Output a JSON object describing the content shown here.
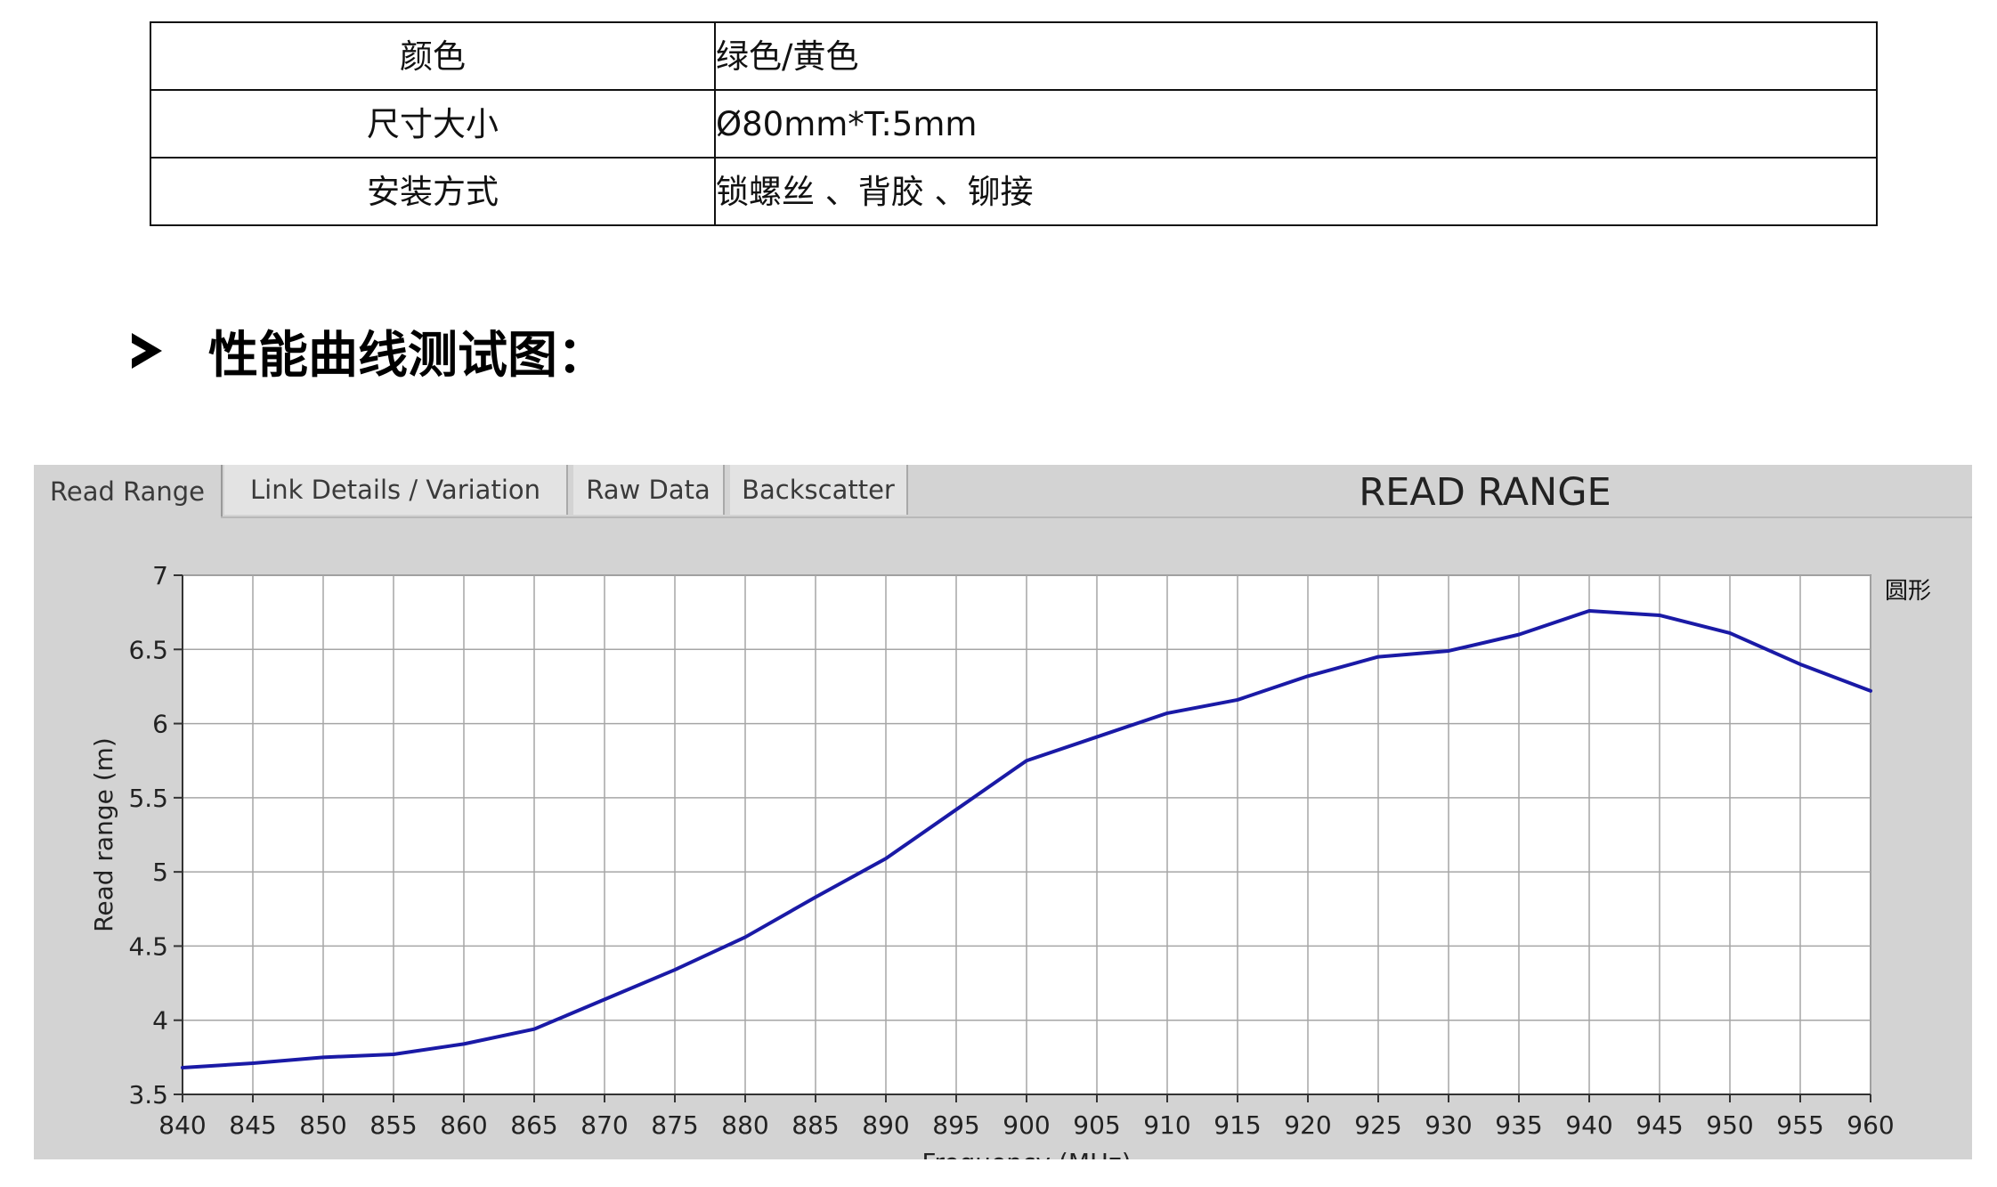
{
  "specs": [
    {
      "key": "颜色",
      "value": "绿色/黄色"
    },
    {
      "key": "尺寸大小",
      "value": "Ø80mm*T:5mm"
    },
    {
      "key": "安装方式",
      "value": "锁螺丝 、背胶 、铆接"
    }
  ],
  "section": {
    "heading": "性能曲线测试图："
  },
  "app": {
    "tabs": [
      {
        "label": "Read Range",
        "active": true
      },
      {
        "label": "Link Details / Variation",
        "active": false
      },
      {
        "label": "Raw Data",
        "active": false
      },
      {
        "label": "Backscatter",
        "active": false
      }
    ]
  },
  "chart_data": {
    "type": "line",
    "title": "READ RANGE",
    "xlabel": "Frequency (MHz)",
    "ylabel": "Read range (m)",
    "xlim": [
      840,
      960
    ],
    "ylim": [
      3.5,
      7
    ],
    "xticks": [
      840,
      845,
      850,
      855,
      860,
      865,
      870,
      875,
      880,
      885,
      890,
      895,
      900,
      905,
      910,
      915,
      920,
      925,
      930,
      935,
      940,
      945,
      950,
      955,
      960
    ],
    "yticks": [
      3.5,
      4,
      4.5,
      5,
      5.5,
      6,
      6.5,
      7
    ],
    "grid": true,
    "legend": "right",
    "series": [
      {
        "name": "圆形",
        "color": "#1a1aa6",
        "x": [
          840,
          845,
          850,
          855,
          860,
          865,
          870,
          875,
          880,
          885,
          890,
          895,
          900,
          905,
          910,
          915,
          920,
          925,
          930,
          935,
          940,
          945,
          950,
          955,
          960
        ],
        "y": [
          3.68,
          3.71,
          3.75,
          3.77,
          3.84,
          3.94,
          4.14,
          4.34,
          4.56,
          4.83,
          5.09,
          5.42,
          5.75,
          5.91,
          6.07,
          6.16,
          6.32,
          6.45,
          6.49,
          6.6,
          6.76,
          6.73,
          6.61,
          6.4,
          6.22
        ]
      }
    ]
  }
}
